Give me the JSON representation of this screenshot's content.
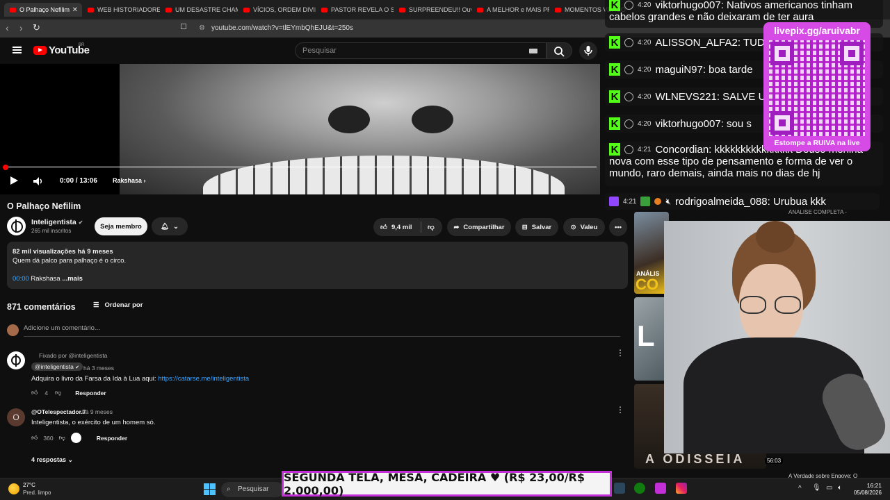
{
  "browser": {
    "tabs": [
      {
        "label": "O Palhaço Nefilim",
        "active": true
      },
      {
        "label": "WEB HISTORIADORES"
      },
      {
        "label": "UM DESASTRE CHAM"
      },
      {
        "label": "VÍCIOS, ORDEM DIVIN"
      },
      {
        "label": "PASTOR REVELA O SE"
      },
      {
        "label": "SURPREENDEU!! Ouv"
      },
      {
        "label": "A MELHOR e MAIS PR"
      },
      {
        "label": "MOMENTOS VERGO"
      }
    ],
    "url": "youtube.com/watch?v=tlEYmbQhEJU&t=250s"
  },
  "header": {
    "logo_text": "YouTube",
    "region": "BR",
    "search_placeholder": "Pesquisar"
  },
  "player": {
    "time": "0:00 / 13:06",
    "chapter": "Rakshasa",
    "progress": 0.0
  },
  "video": {
    "title": "O Palhaço Nefilim",
    "channel": "Inteligentista",
    "subscribers": "265 mil inscritos",
    "join_label": "Seja membro",
    "likes": "9,4 mil",
    "share_label": "Compartilhar",
    "save_label": "Salvar",
    "thanks_label": "Valeu"
  },
  "description": {
    "stats": "82 mil visualizações  há 9 meses",
    "text": "Quem dá palco para palhaço é o circo.",
    "chapter_time": "00:00",
    "chapter_name": "Rakshasa",
    "more": "...mais"
  },
  "comments": {
    "count_label": "871 comentários",
    "sort_label": "Ordenar por",
    "add_placeholder": "Adicione um comentário...",
    "items": [
      {
        "pinned": "Fixado por @inteligentista",
        "author": "@inteligentista",
        "time": "há 3 meses",
        "text": "Adquira o livro da Farsa da Ida à Lua aqui: ",
        "link": "https://catarse.me/inteligentista",
        "likes": "4",
        "reply": "Responder"
      },
      {
        "author": "@OTelespectador.7",
        "time": "há 9 meses",
        "text": "Inteligentista, o exército de um homem só.",
        "likes": "360",
        "reply": "Responder",
        "replies": "4 respostas",
        "avatar_letter": "O"
      }
    ]
  },
  "chat": [
    {
      "time": "4:20",
      "text": "viktorhugo007: Nativos americanos tinham",
      "cont": "cabelos grandes e não deixaram de ter aura"
    },
    {
      "time": "4:20",
      "text": "ALISSON_ALFA2: TUD"
    },
    {
      "time": "4:20",
      "text": "maguiN97: boa tarde"
    },
    {
      "time": "4:20",
      "text": "WLNEVS221: SALVE U"
    },
    {
      "time": "4:20",
      "text": "viktorhugo007: sou s"
    },
    {
      "time": "4:21",
      "text": "Concordian: kkkkkkkkkkkkkkk Deuso menina",
      "cont": "nova com esse tipo de pensamento e forma de ver o",
      "cont2": "mundo, raro demais, ainda mais no dias de hj"
    },
    {
      "time": "4:21",
      "text": "rodrigoalmeida_088: Urubua kkk"
    }
  ],
  "qr": {
    "title": "livepix.gg/aruivabr",
    "caption": "Estompe a RUIVA na live"
  },
  "sidebar": {
    "label1": "ANÁLISE COMPLETA -",
    "thumb_text1": "ANÁLIS",
    "thumb_text1b": "CO",
    "thumb_text2": "L",
    "thumb_text3": "A ODISSEIA",
    "duration": "56:03",
    "bottom_title": "A Verdade sobre Engove: O"
  },
  "banner": {
    "text": "SEGUNDA TELA, MESA, CADEIRA ♥ (R$ 23,00/R$ 2.000,00)"
  },
  "taskbar": {
    "temp": "27°C",
    "weather": "Pred. limpo",
    "search": "Pesquisar",
    "time": "16:21",
    "date": "05/08/2026"
  },
  "colors": {
    "accent_red": "#ff0000",
    "kick_green": "#53fc18",
    "livepix_purple": "#d64be6",
    "link_blue": "#3ea6ff"
  }
}
